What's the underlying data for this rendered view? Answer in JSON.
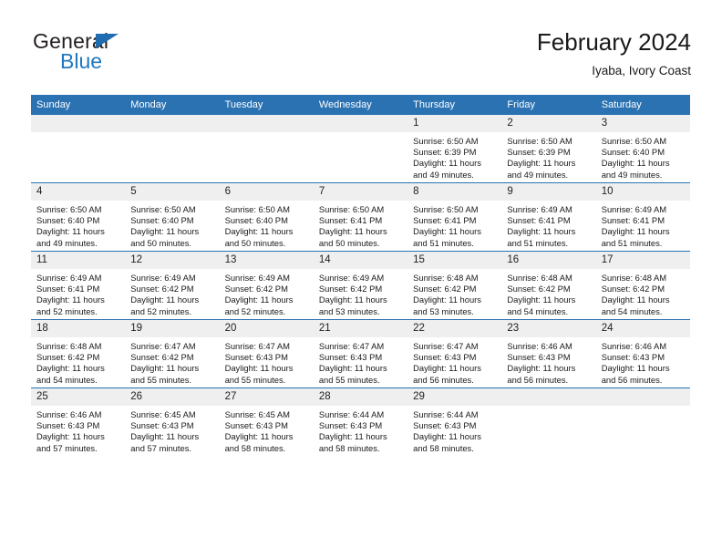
{
  "brand": {
    "name_top": "General",
    "name_bottom": "Blue",
    "triangle_color": "#1f6cb0",
    "blue_color": "#1f78c1",
    "dark_color": "#231f20"
  },
  "header": {
    "title": "February 2024",
    "subtitle": "Iyaba, Ivory Coast"
  },
  "theme": {
    "header_blue": "#2b72b2",
    "daynum_gray": "#efefef",
    "cell_white": "#ffffff",
    "text": "#1a1a1a"
  },
  "calendar": {
    "weekday_headers": [
      "Sunday",
      "Monday",
      "Tuesday",
      "Wednesday",
      "Thursday",
      "Friday",
      "Saturday"
    ],
    "labels": {
      "sunrise_prefix": "Sunrise:",
      "sunset_prefix": "Sunset:",
      "daylight_prefix": "Daylight:"
    },
    "weeks": [
      [
        {
          "day": "",
          "sunrise": "",
          "sunset": "",
          "daylight_a": "",
          "daylight_b": ""
        },
        {
          "day": "",
          "sunrise": "",
          "sunset": "",
          "daylight_a": "",
          "daylight_b": ""
        },
        {
          "day": "",
          "sunrise": "",
          "sunset": "",
          "daylight_a": "",
          "daylight_b": ""
        },
        {
          "day": "",
          "sunrise": "",
          "sunset": "",
          "daylight_a": "",
          "daylight_b": ""
        },
        {
          "day": "1",
          "sunrise": "Sunrise: 6:50 AM",
          "sunset": "Sunset: 6:39 PM",
          "daylight_a": "Daylight: 11 hours",
          "daylight_b": "and 49 minutes."
        },
        {
          "day": "2",
          "sunrise": "Sunrise: 6:50 AM",
          "sunset": "Sunset: 6:39 PM",
          "daylight_a": "Daylight: 11 hours",
          "daylight_b": "and 49 minutes."
        },
        {
          "day": "3",
          "sunrise": "Sunrise: 6:50 AM",
          "sunset": "Sunset: 6:40 PM",
          "daylight_a": "Daylight: 11 hours",
          "daylight_b": "and 49 minutes."
        }
      ],
      [
        {
          "day": "4",
          "sunrise": "Sunrise: 6:50 AM",
          "sunset": "Sunset: 6:40 PM",
          "daylight_a": "Daylight: 11 hours",
          "daylight_b": "and 49 minutes."
        },
        {
          "day": "5",
          "sunrise": "Sunrise: 6:50 AM",
          "sunset": "Sunset: 6:40 PM",
          "daylight_a": "Daylight: 11 hours",
          "daylight_b": "and 50 minutes."
        },
        {
          "day": "6",
          "sunrise": "Sunrise: 6:50 AM",
          "sunset": "Sunset: 6:40 PM",
          "daylight_a": "Daylight: 11 hours",
          "daylight_b": "and 50 minutes."
        },
        {
          "day": "7",
          "sunrise": "Sunrise: 6:50 AM",
          "sunset": "Sunset: 6:41 PM",
          "daylight_a": "Daylight: 11 hours",
          "daylight_b": "and 50 minutes."
        },
        {
          "day": "8",
          "sunrise": "Sunrise: 6:50 AM",
          "sunset": "Sunset: 6:41 PM",
          "daylight_a": "Daylight: 11 hours",
          "daylight_b": "and 51 minutes."
        },
        {
          "day": "9",
          "sunrise": "Sunrise: 6:49 AM",
          "sunset": "Sunset: 6:41 PM",
          "daylight_a": "Daylight: 11 hours",
          "daylight_b": "and 51 minutes."
        },
        {
          "day": "10",
          "sunrise": "Sunrise: 6:49 AM",
          "sunset": "Sunset: 6:41 PM",
          "daylight_a": "Daylight: 11 hours",
          "daylight_b": "and 51 minutes."
        }
      ],
      [
        {
          "day": "11",
          "sunrise": "Sunrise: 6:49 AM",
          "sunset": "Sunset: 6:41 PM",
          "daylight_a": "Daylight: 11 hours",
          "daylight_b": "and 52 minutes."
        },
        {
          "day": "12",
          "sunrise": "Sunrise: 6:49 AM",
          "sunset": "Sunset: 6:42 PM",
          "daylight_a": "Daylight: 11 hours",
          "daylight_b": "and 52 minutes."
        },
        {
          "day": "13",
          "sunrise": "Sunrise: 6:49 AM",
          "sunset": "Sunset: 6:42 PM",
          "daylight_a": "Daylight: 11 hours",
          "daylight_b": "and 52 minutes."
        },
        {
          "day": "14",
          "sunrise": "Sunrise: 6:49 AM",
          "sunset": "Sunset: 6:42 PM",
          "daylight_a": "Daylight: 11 hours",
          "daylight_b": "and 53 minutes."
        },
        {
          "day": "15",
          "sunrise": "Sunrise: 6:48 AM",
          "sunset": "Sunset: 6:42 PM",
          "daylight_a": "Daylight: 11 hours",
          "daylight_b": "and 53 minutes."
        },
        {
          "day": "16",
          "sunrise": "Sunrise: 6:48 AM",
          "sunset": "Sunset: 6:42 PM",
          "daylight_a": "Daylight: 11 hours",
          "daylight_b": "and 54 minutes."
        },
        {
          "day": "17",
          "sunrise": "Sunrise: 6:48 AM",
          "sunset": "Sunset: 6:42 PM",
          "daylight_a": "Daylight: 11 hours",
          "daylight_b": "and 54 minutes."
        }
      ],
      [
        {
          "day": "18",
          "sunrise": "Sunrise: 6:48 AM",
          "sunset": "Sunset: 6:42 PM",
          "daylight_a": "Daylight: 11 hours",
          "daylight_b": "and 54 minutes."
        },
        {
          "day": "19",
          "sunrise": "Sunrise: 6:47 AM",
          "sunset": "Sunset: 6:42 PM",
          "daylight_a": "Daylight: 11 hours",
          "daylight_b": "and 55 minutes."
        },
        {
          "day": "20",
          "sunrise": "Sunrise: 6:47 AM",
          "sunset": "Sunset: 6:43 PM",
          "daylight_a": "Daylight: 11 hours",
          "daylight_b": "and 55 minutes."
        },
        {
          "day": "21",
          "sunrise": "Sunrise: 6:47 AM",
          "sunset": "Sunset: 6:43 PM",
          "daylight_a": "Daylight: 11 hours",
          "daylight_b": "and 55 minutes."
        },
        {
          "day": "22",
          "sunrise": "Sunrise: 6:47 AM",
          "sunset": "Sunset: 6:43 PM",
          "daylight_a": "Daylight: 11 hours",
          "daylight_b": "and 56 minutes."
        },
        {
          "day": "23",
          "sunrise": "Sunrise: 6:46 AM",
          "sunset": "Sunset: 6:43 PM",
          "daylight_a": "Daylight: 11 hours",
          "daylight_b": "and 56 minutes."
        },
        {
          "day": "24",
          "sunrise": "Sunrise: 6:46 AM",
          "sunset": "Sunset: 6:43 PM",
          "daylight_a": "Daylight: 11 hours",
          "daylight_b": "and 56 minutes."
        }
      ],
      [
        {
          "day": "25",
          "sunrise": "Sunrise: 6:46 AM",
          "sunset": "Sunset: 6:43 PM",
          "daylight_a": "Daylight: 11 hours",
          "daylight_b": "and 57 minutes."
        },
        {
          "day": "26",
          "sunrise": "Sunrise: 6:45 AM",
          "sunset": "Sunset: 6:43 PM",
          "daylight_a": "Daylight: 11 hours",
          "daylight_b": "and 57 minutes."
        },
        {
          "day": "27",
          "sunrise": "Sunrise: 6:45 AM",
          "sunset": "Sunset: 6:43 PM",
          "daylight_a": "Daylight: 11 hours",
          "daylight_b": "and 58 minutes."
        },
        {
          "day": "28",
          "sunrise": "Sunrise: 6:44 AM",
          "sunset": "Sunset: 6:43 PM",
          "daylight_a": "Daylight: 11 hours",
          "daylight_b": "and 58 minutes."
        },
        {
          "day": "29",
          "sunrise": "Sunrise: 6:44 AM",
          "sunset": "Sunset: 6:43 PM",
          "daylight_a": "Daylight: 11 hours",
          "daylight_b": "and 58 minutes."
        },
        {
          "day": "",
          "sunrise": "",
          "sunset": "",
          "daylight_a": "",
          "daylight_b": ""
        },
        {
          "day": "",
          "sunrise": "",
          "sunset": "",
          "daylight_a": "",
          "daylight_b": ""
        }
      ]
    ]
  }
}
